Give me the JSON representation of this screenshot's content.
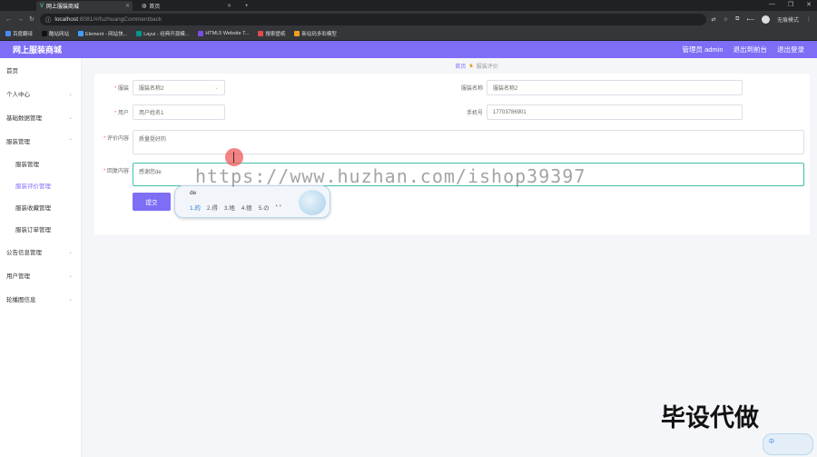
{
  "browser": {
    "tabs": [
      {
        "title": "网上服装商城",
        "active": true
      },
      {
        "title": "首页",
        "active": false
      }
    ],
    "new_tab": "+",
    "url_host": "localhost",
    "url_rest": ":8081/#/fuzhuangCommentback",
    "profile": "无痕模式",
    "bookmarks": [
      {
        "label": "百度翻译",
        "color": "#4a8df0"
      },
      {
        "label": "酷站网站",
        "color": "#222"
      },
      {
        "label": "Element - 网站快...",
        "color": "#409eff"
      },
      {
        "label": "Layui - 经典开源模...",
        "color": "#009688"
      },
      {
        "label": "HTML5 Website T...",
        "color": "#7b4ce0"
      },
      {
        "label": "搜索壁纸",
        "color": "#e04c4c"
      },
      {
        "label": "新站码多彩模型",
        "color": "#f0a020"
      }
    ]
  },
  "app": {
    "title": "网上服装商城",
    "admin": "管理员 admin",
    "exit_front": "退出到前台",
    "logout": "退出登录"
  },
  "sidebar": {
    "items": [
      {
        "label": "首页",
        "sub": false,
        "chevron": false
      },
      {
        "label": "个人中心",
        "sub": false,
        "chevron": true
      },
      {
        "label": "基础数据管理",
        "sub": false,
        "chevron": true
      },
      {
        "label": "服装管理",
        "sub": false,
        "chevron": true
      },
      {
        "label": "服装管理",
        "sub": true,
        "chevron": false
      },
      {
        "label": "服装评价管理",
        "sub": true,
        "chevron": false,
        "active": true
      },
      {
        "label": "服装收藏管理",
        "sub": true,
        "chevron": false
      },
      {
        "label": "服装订单管理",
        "sub": true,
        "chevron": false
      },
      {
        "label": "公告信息管理",
        "sub": false,
        "chevron": true
      },
      {
        "label": "用户管理",
        "sub": false,
        "chevron": true
      },
      {
        "label": "轮播图信息",
        "sub": false,
        "chevron": true
      }
    ]
  },
  "breadcrumb": {
    "home": "首页",
    "current": "服装评价"
  },
  "form": {
    "fuzhuang_label": "服装",
    "fuzhuang_value": "服装名称2",
    "fuzhuang_name_label": "服装名称",
    "fuzhuang_name_value": "服装名称2",
    "user_label": "用户",
    "user_value": "用户姓名1",
    "user_phone_label": "手机号",
    "user_phone_value": "17703786901",
    "comment_label": "评价内容",
    "comment_value": "质量挺好的",
    "reply_label": "回复内容",
    "reply_value": "感谢您de",
    "submit": "提交",
    "cancel": ""
  },
  "ime": {
    "pinyin": "de",
    "candidates": [
      "1.的",
      "2.得",
      "3.地",
      "4.德",
      "5.の"
    ],
    "arrows": "‹ ›"
  },
  "overlay": {
    "watermark": "https://www.huzhan.com/ishop39397",
    "promo": "毕设代做",
    "corner_ime": "中"
  }
}
